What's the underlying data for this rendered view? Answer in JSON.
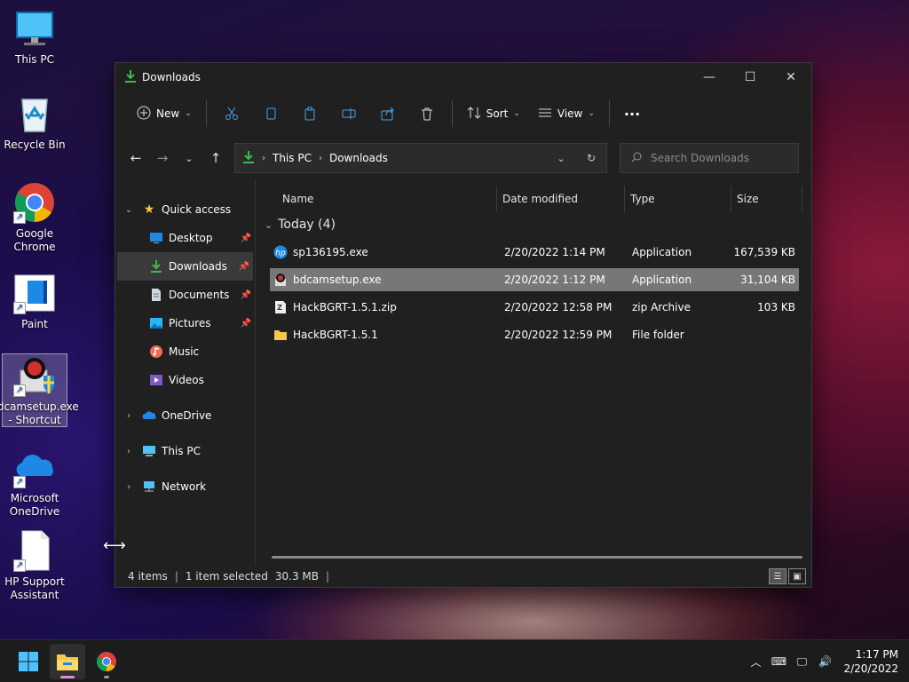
{
  "desktop": {
    "icons": [
      {
        "label": "This PC"
      },
      {
        "label": "Recycle Bin"
      },
      {
        "label": "Google Chrome"
      },
      {
        "label": "Paint"
      },
      {
        "label": "bdcamsetup.exe - Shortcut"
      },
      {
        "label": "Microsoft OneDrive"
      },
      {
        "label": "HP Support Assistant"
      }
    ]
  },
  "window": {
    "title": "Downloads",
    "toolbar": {
      "new_label": "New",
      "sort_label": "Sort",
      "view_label": "View",
      "more_label": "···"
    },
    "address": {
      "crumbs": [
        "This PC",
        "Downloads"
      ]
    },
    "search": {
      "placeholder": "Search Downloads"
    },
    "nav": {
      "quick_access": "Quick access",
      "items": [
        {
          "label": "Desktop"
        },
        {
          "label": "Downloads"
        },
        {
          "label": "Documents"
        },
        {
          "label": "Pictures"
        },
        {
          "label": "Music"
        },
        {
          "label": "Videos"
        }
      ],
      "onedrive": "OneDrive",
      "this_pc": "This PC",
      "network": "Network"
    },
    "columns": {
      "name": "Name",
      "date": "Date modified",
      "type": "Type",
      "size": "Size"
    },
    "group": "Today (4)",
    "files": [
      {
        "name": "sp136195.exe",
        "date": "2/20/2022 1:14 PM",
        "type": "Application",
        "size": "167,539 KB"
      },
      {
        "name": "bdcamsetup.exe",
        "date": "2/20/2022 1:12 PM",
        "type": "Application",
        "size": "31,104 KB"
      },
      {
        "name": "HackBGRT-1.5.1.zip",
        "date": "2/20/2022 12:58 PM",
        "type": "zip Archive",
        "size": "103 KB"
      },
      {
        "name": "HackBGRT-1.5.1",
        "date": "2/20/2022 12:59 PM",
        "type": "File folder",
        "size": ""
      }
    ],
    "status": {
      "items": "4 items",
      "selected": "1 item selected",
      "size": "30.3 MB"
    }
  },
  "taskbar": {
    "time": "1:17 PM",
    "date": "2/20/2022"
  },
  "colors": {
    "accent_green": "#3fb950",
    "folder_yellow": "#f7c948",
    "selection": "#777777"
  }
}
